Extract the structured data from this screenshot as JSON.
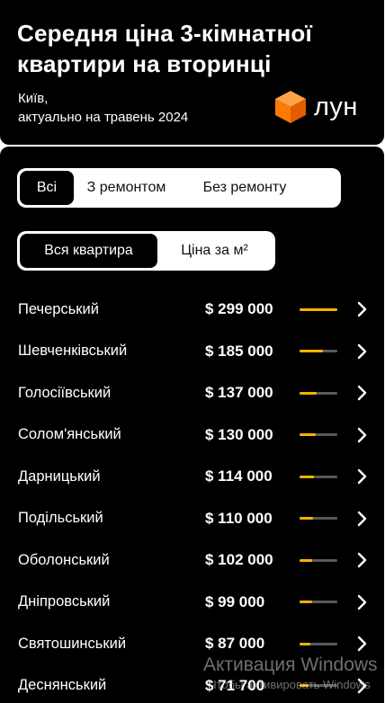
{
  "header": {
    "title": "Середня ціна 3-кімнатної квартири на вторинці",
    "city": "Київ,",
    "period": "актуально на травень 2024",
    "logo_text": "лун",
    "logo_color": "#ff7a00"
  },
  "filters": {
    "renovation": [
      "Всі",
      "З ремонтом",
      "Без ремонту"
    ],
    "renovation_selected": "Всі",
    "price_type": [
      "Вся квартира",
      "Ціна за м²"
    ],
    "price_type_selected": "Вся квартира"
  },
  "districts": [
    {
      "name": "Печерський",
      "price": "$ 299 000",
      "value": 299000
    },
    {
      "name": "Шевченківський",
      "price": "$ 185 000",
      "value": 185000
    },
    {
      "name": "Голосіївський",
      "price": "$ 137 000",
      "value": 137000
    },
    {
      "name": "Солом'янський",
      "price": "$ 130 000",
      "value": 130000
    },
    {
      "name": "Дарницький",
      "price": "$ 114 000",
      "value": 114000
    },
    {
      "name": "Подільський",
      "price": "$ 110 000",
      "value": 110000
    },
    {
      "name": "Оболонський",
      "price": "$ 102 000",
      "value": 102000
    },
    {
      "name": "Дніпровський",
      "price": "$ 99 000",
      "value": 99000
    },
    {
      "name": "Святошинський",
      "price": "$ 87 000",
      "value": 87000
    },
    {
      "name": "Деснянський",
      "price": "$ 71 700",
      "value": 71700
    }
  ],
  "bar_max_value": 299000,
  "colors": {
    "accent": "#ffb100",
    "bar_track": "#5a5a5a",
    "background": "#000000"
  },
  "watermark": {
    "line1": "Активация Windows",
    "line2": "Чтобы активировать Windows"
  }
}
